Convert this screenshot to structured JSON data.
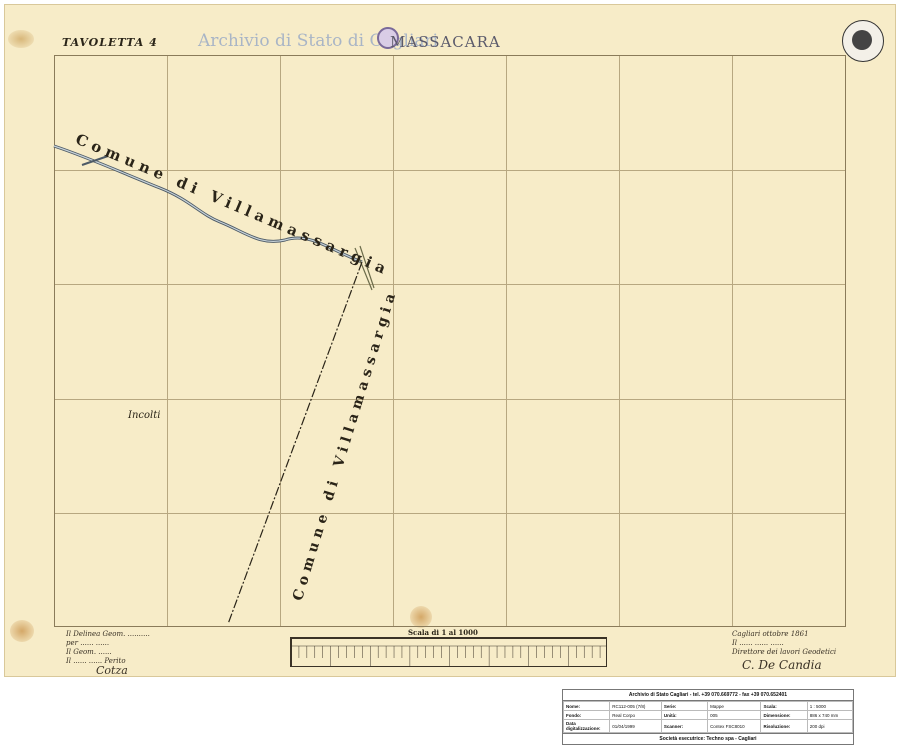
{
  "map": {
    "sheet_label": "TAVOLETTA 4",
    "archive_watermark": "Archivio di Stato di Cagliari",
    "place_name": "MASSACARA",
    "municipality_top": "Comune di Villamassargia",
    "municipality_right": "Comune di Villamassargia",
    "land_label": "Incolti",
    "scale_title": "Scala di 1 al 1000"
  },
  "signatures": {
    "left": [
      "Il Delinea Geom. ..........",
      "per ...... ......",
      "Il Geom. ......",
      "Il ...... ...... Perito"
    ],
    "left_signed": "Cotza",
    "right": [
      "Cagliari ottobre 1861",
      "Il ...... ...... ......",
      "Direttore dei lavori Geodetici"
    ],
    "right_signed": "C. De Candia"
  },
  "info_table": {
    "title": "Archivio di Stato Cagliari - tel. +39 070.669772 - fax +39 070.652401",
    "rows": [
      {
        "l1": "Nome:",
        "v1": "RC112-005 (7/8)",
        "l2": "Serie:",
        "v2": "Mappe",
        "l3": "Scala:",
        "v3": "1 : 5000"
      },
      {
        "l1": "Fondo:",
        "v1": "Real Corpo",
        "l2": "Unità:",
        "v2": "005",
        "l3": "Dimensione:",
        "v3": "886 x 740 mm"
      },
      {
        "l1": "Data digitalizzazione:",
        "v1": "01/04/1999",
        "l2": "Scanner:",
        "v2": "Contex FSC8010",
        "l3": "Risoluzione:",
        "v3": "200 dpi"
      }
    ],
    "footer": "Società esecutrice: Techno spa - Cagliari"
  }
}
